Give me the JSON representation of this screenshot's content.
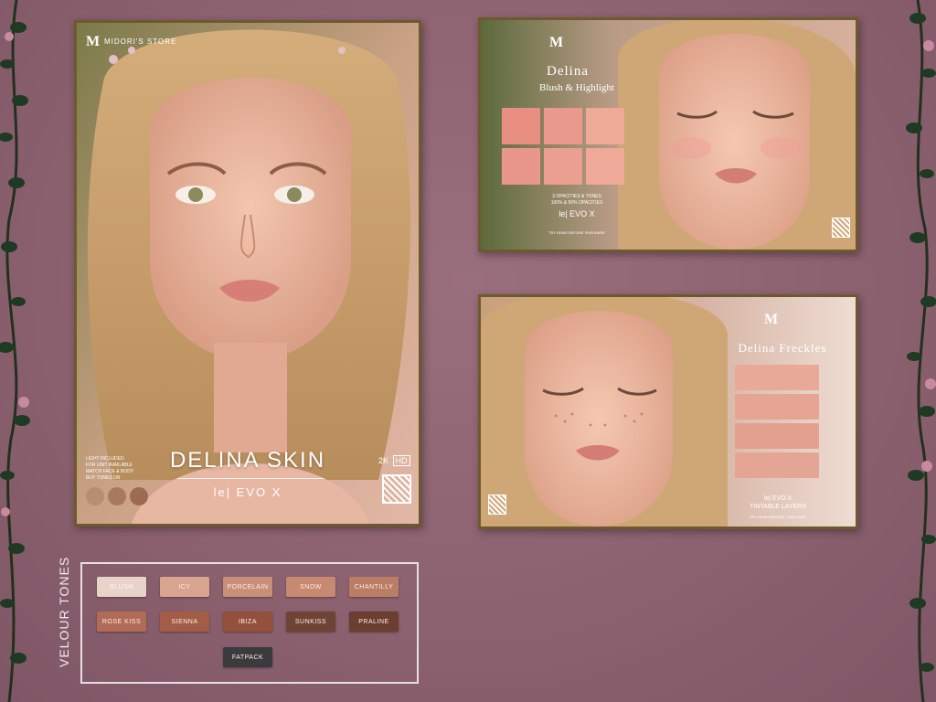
{
  "colors": {
    "wall": "#8e6472",
    "frame": "#6d5a2c",
    "vend_border": "#e9dfe3"
  },
  "main_poster": {
    "store_logo": "M",
    "store_name": "MIDORI'S STORE",
    "title": "DELINA SKIN",
    "subtitle": "le| EVO X",
    "badge": "2K",
    "badge_hd": "HD",
    "fine_print": [
      "LIGHT INCLUDED",
      "FOR UNIT AVAILABLE",
      "MATCH FACE & BODY",
      "BUY TONES ON"
    ]
  },
  "blush_poster": {
    "store_logo": "M",
    "title": "Delina",
    "subtitle": "Blush & Highlight",
    "details": [
      "3 OPACITIES & TONES",
      "100% & 50% OPACITIES"
    ],
    "head": "le| EVO X",
    "footer": "TRY DEMO BEFORE PURCHASE"
  },
  "freckles_poster": {
    "store_logo": "M",
    "title": "Delina Freckles",
    "details": [
      "le| EVO X",
      "TINTABLE LAYERS"
    ],
    "footer": "TRY DEMO BEFORE PURCHASE"
  },
  "vendor": {
    "title": "VELOUR TONES",
    "tones": [
      {
        "label": "BLUSH",
        "color": "#e9d2c8"
      },
      {
        "label": "ICY",
        "color": "#d8a490"
      },
      {
        "label": "PORCELAIN",
        "color": "#c98f78"
      },
      {
        "label": "SNOW",
        "color": "#c7896f"
      },
      {
        "label": "CHANTILLY",
        "color": "#bb7d64"
      },
      {
        "label": "ROSE KISS",
        "color": "#b26b56"
      },
      {
        "label": "SIENNA",
        "color": "#a35d46"
      },
      {
        "label": "IBIZA",
        "color": "#93513c"
      },
      {
        "label": "SUNKISS",
        "color": "#6f4435"
      },
      {
        "label": "PRALINE",
        "color": "#6b3e30"
      }
    ],
    "fatpack": {
      "label": "FATPACK",
      "color": "#3b3a3c"
    }
  }
}
